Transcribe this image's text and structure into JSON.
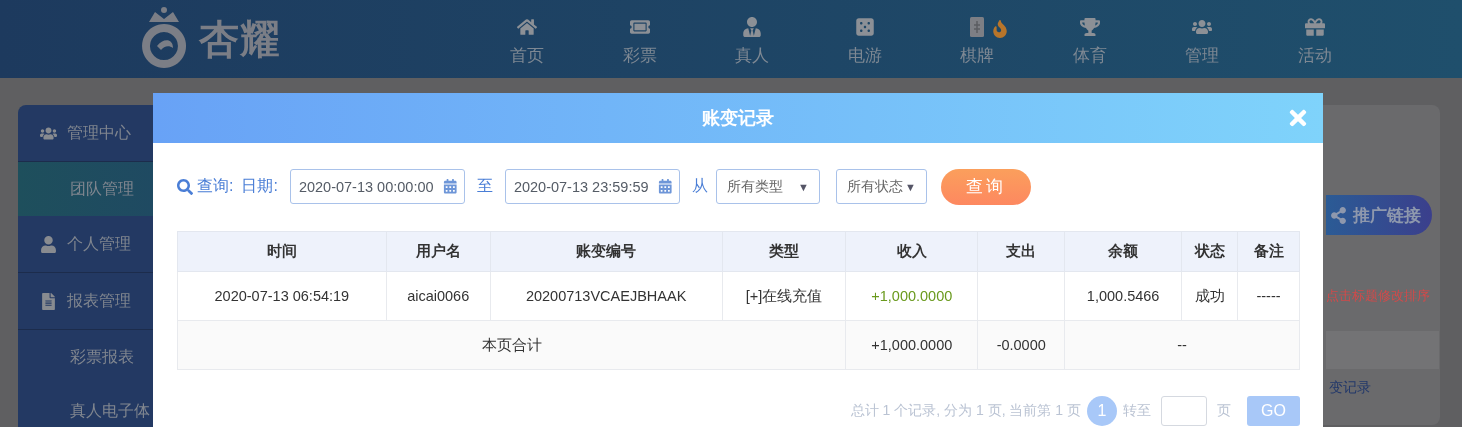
{
  "logo": {
    "text": "杏耀"
  },
  "nav": [
    {
      "label": "首页",
      "hot": false
    },
    {
      "label": "彩票",
      "hot": false
    },
    {
      "label": "真人",
      "hot": false
    },
    {
      "label": "电游",
      "hot": false
    },
    {
      "label": "棋牌",
      "hot": true
    },
    {
      "label": "体育",
      "hot": false
    },
    {
      "label": "管理",
      "hot": false
    },
    {
      "label": "活动",
      "hot": false
    }
  ],
  "sidebar": {
    "items": [
      {
        "kind": "group",
        "label": "管理中心",
        "selected": false
      },
      {
        "kind": "item",
        "label": "团队管理",
        "selected": true
      },
      {
        "kind": "group",
        "label": "个人管理",
        "selected": false
      },
      {
        "kind": "group",
        "label": "报表管理",
        "selected": false
      },
      {
        "kind": "item",
        "label": "彩票报表",
        "selected": false
      },
      {
        "kind": "item",
        "label": "真人电子体",
        "selected": false
      }
    ]
  },
  "panel": {
    "promo_button": "推广链接",
    "hint": "点击标题修改排序",
    "link": "变记录"
  },
  "modal": {
    "title": "账变记录",
    "filters": {
      "search_label": "查询:",
      "date_label": "日期:",
      "from": "2020-07-13 00:00:00",
      "separator": "至",
      "to": "2020-07-13 23:59:59",
      "type_label": "从",
      "type_select": "所有类型",
      "status_select": "所有状态",
      "select_caret": "▼",
      "button": "查询"
    },
    "table": {
      "columns": [
        "时间",
        "用户名",
        "账变编号",
        "类型",
        "收入",
        "支出",
        "余额",
        "状态",
        "备注"
      ],
      "rows": [
        [
          "2020-07-13 06:54:19",
          "aicai0066",
          "20200713VCAEJBHAAK",
          "[+]在线充值",
          "+1,000.0000",
          "",
          "1,000.5466",
          "成功",
          "-----"
        ]
      ],
      "summary": {
        "label": "本页合计",
        "income": "+1,000.0000",
        "expense": "-0.0000",
        "balance": "--"
      }
    },
    "pagination": {
      "summary": "总计 1 个记录, 分为 1 页, 当前第 1 页",
      "pages": [
        {
          "label": "1",
          "selected": true
        }
      ],
      "goto": "转至",
      "unit": "页",
      "go": "GO"
    }
  }
}
